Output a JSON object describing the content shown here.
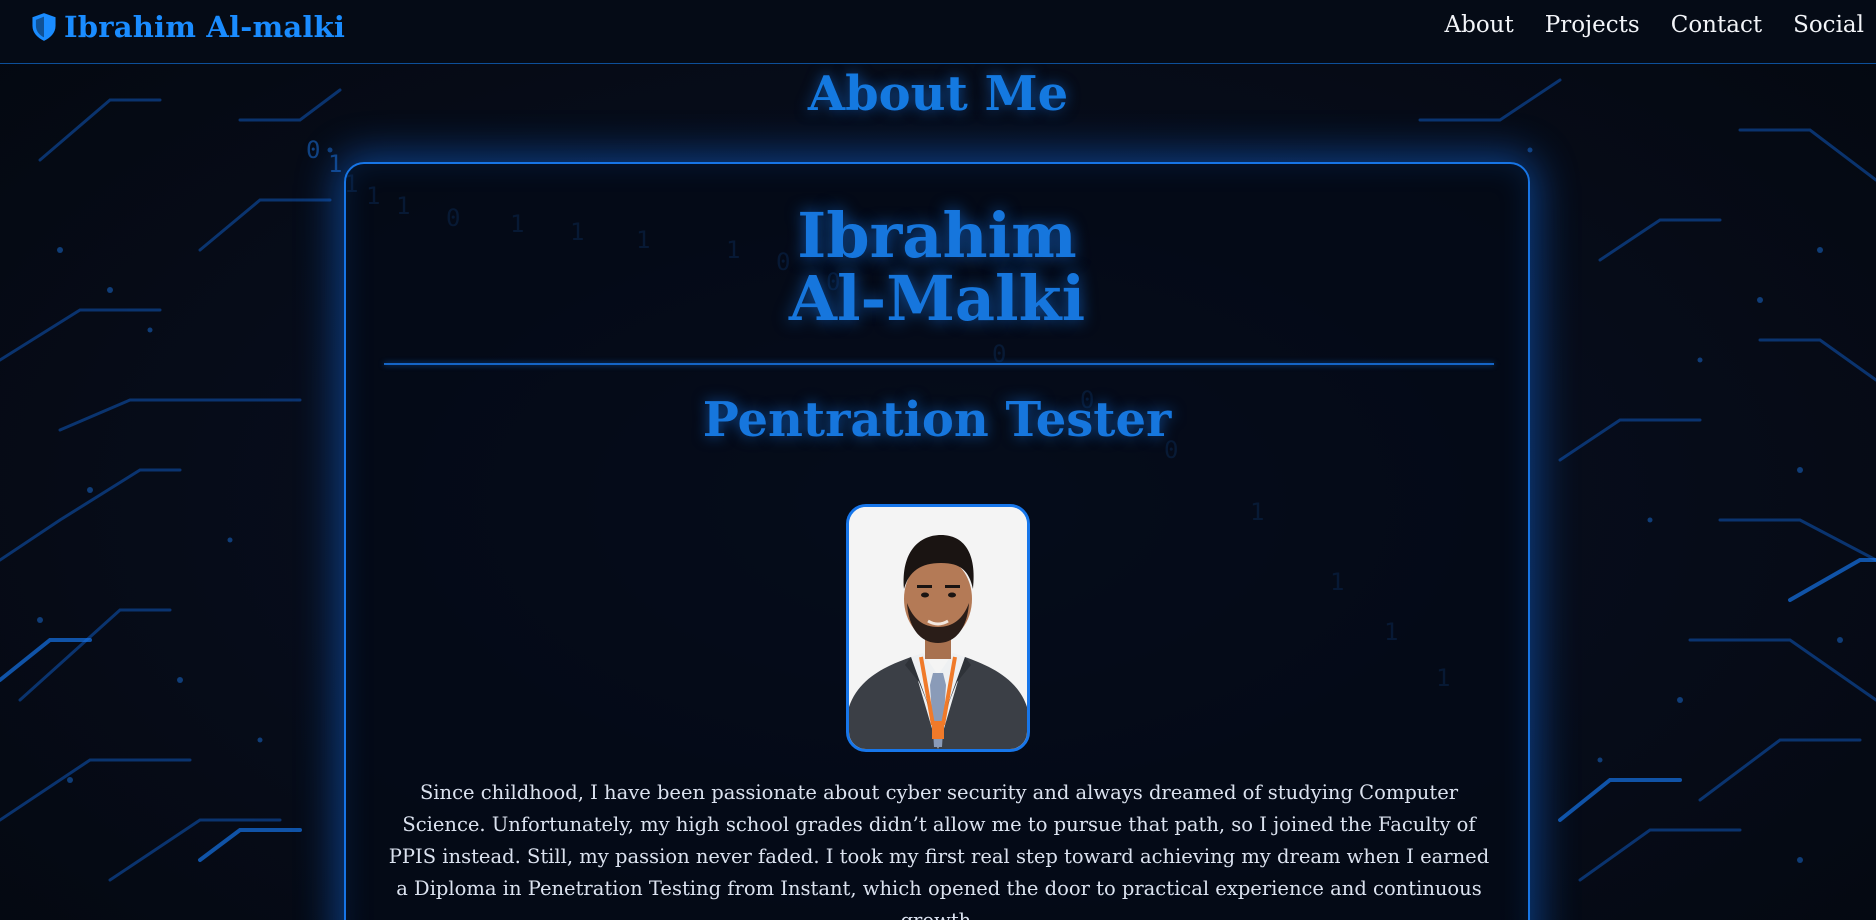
{
  "navbar": {
    "brand_name": "Ibrahim Al-malki",
    "brand_icon": "shield-icon",
    "links": [
      {
        "label": "About"
      },
      {
        "label": "Projects"
      },
      {
        "label": "Contact"
      },
      {
        "label": "Social"
      }
    ]
  },
  "about": {
    "section_title": "About Me",
    "name_line1": "Ibrahim",
    "name_line2": "Al-Malki",
    "role": "Pentration Tester",
    "portrait_alt": "profile-photo",
    "bio": "Since childhood, I have been passionate about cyber security and always dreamed of studying Computer Science. Unfortunately, my high school grades didn’t allow me to pursue that path, so I joined the Faculty of PPIS instead. Still, my passion never faded. I took my first real step toward achieving my dream when I earned a Diploma in Penetration Testing from Instant, which opened the door to practical experience and continuous growth."
  },
  "theme": {
    "accent": "#1a8cff",
    "background": "#050a14",
    "text": "#dbe2ef"
  }
}
